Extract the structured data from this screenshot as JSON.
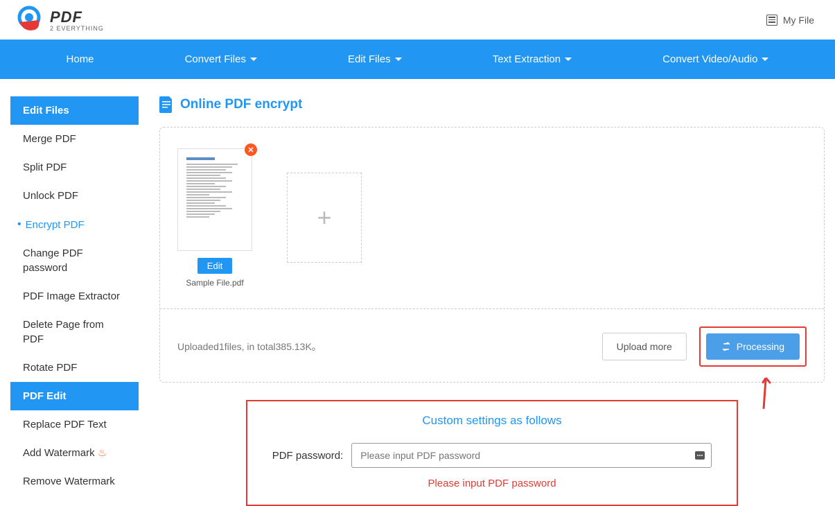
{
  "header": {
    "logo_main": "PDF",
    "logo_sub": "2 EVERYTHING",
    "myfile": "My File"
  },
  "nav": {
    "items": [
      "Home",
      "Convert Files",
      "Edit Files",
      "Text Extraction",
      "Convert Video/Audio"
    ]
  },
  "sidebar": {
    "header1": "Edit Files",
    "items1": [
      "Merge PDF",
      "Split PDF",
      "Unlock PDF",
      "Encrypt PDF",
      "Change PDF password",
      "PDF Image Extractor",
      "Delete Page from PDF",
      "Rotate PDF"
    ],
    "header2": "PDF Edit",
    "items2": [
      "Replace PDF Text",
      "Add Watermark",
      "Remove Watermark"
    ]
  },
  "page": {
    "title": "Online PDF encrypt"
  },
  "file": {
    "edit_label": "Edit",
    "name": "Sample File.pdf"
  },
  "upload": {
    "status": "Uploaded1files, in total385.13K。",
    "more_btn": "Upload more",
    "process_btn": "Processing"
  },
  "settings": {
    "title": "Custom settings as follows",
    "label": "PDF password:",
    "placeholder": "Please input PDF password",
    "error": "Please input PDF password"
  }
}
